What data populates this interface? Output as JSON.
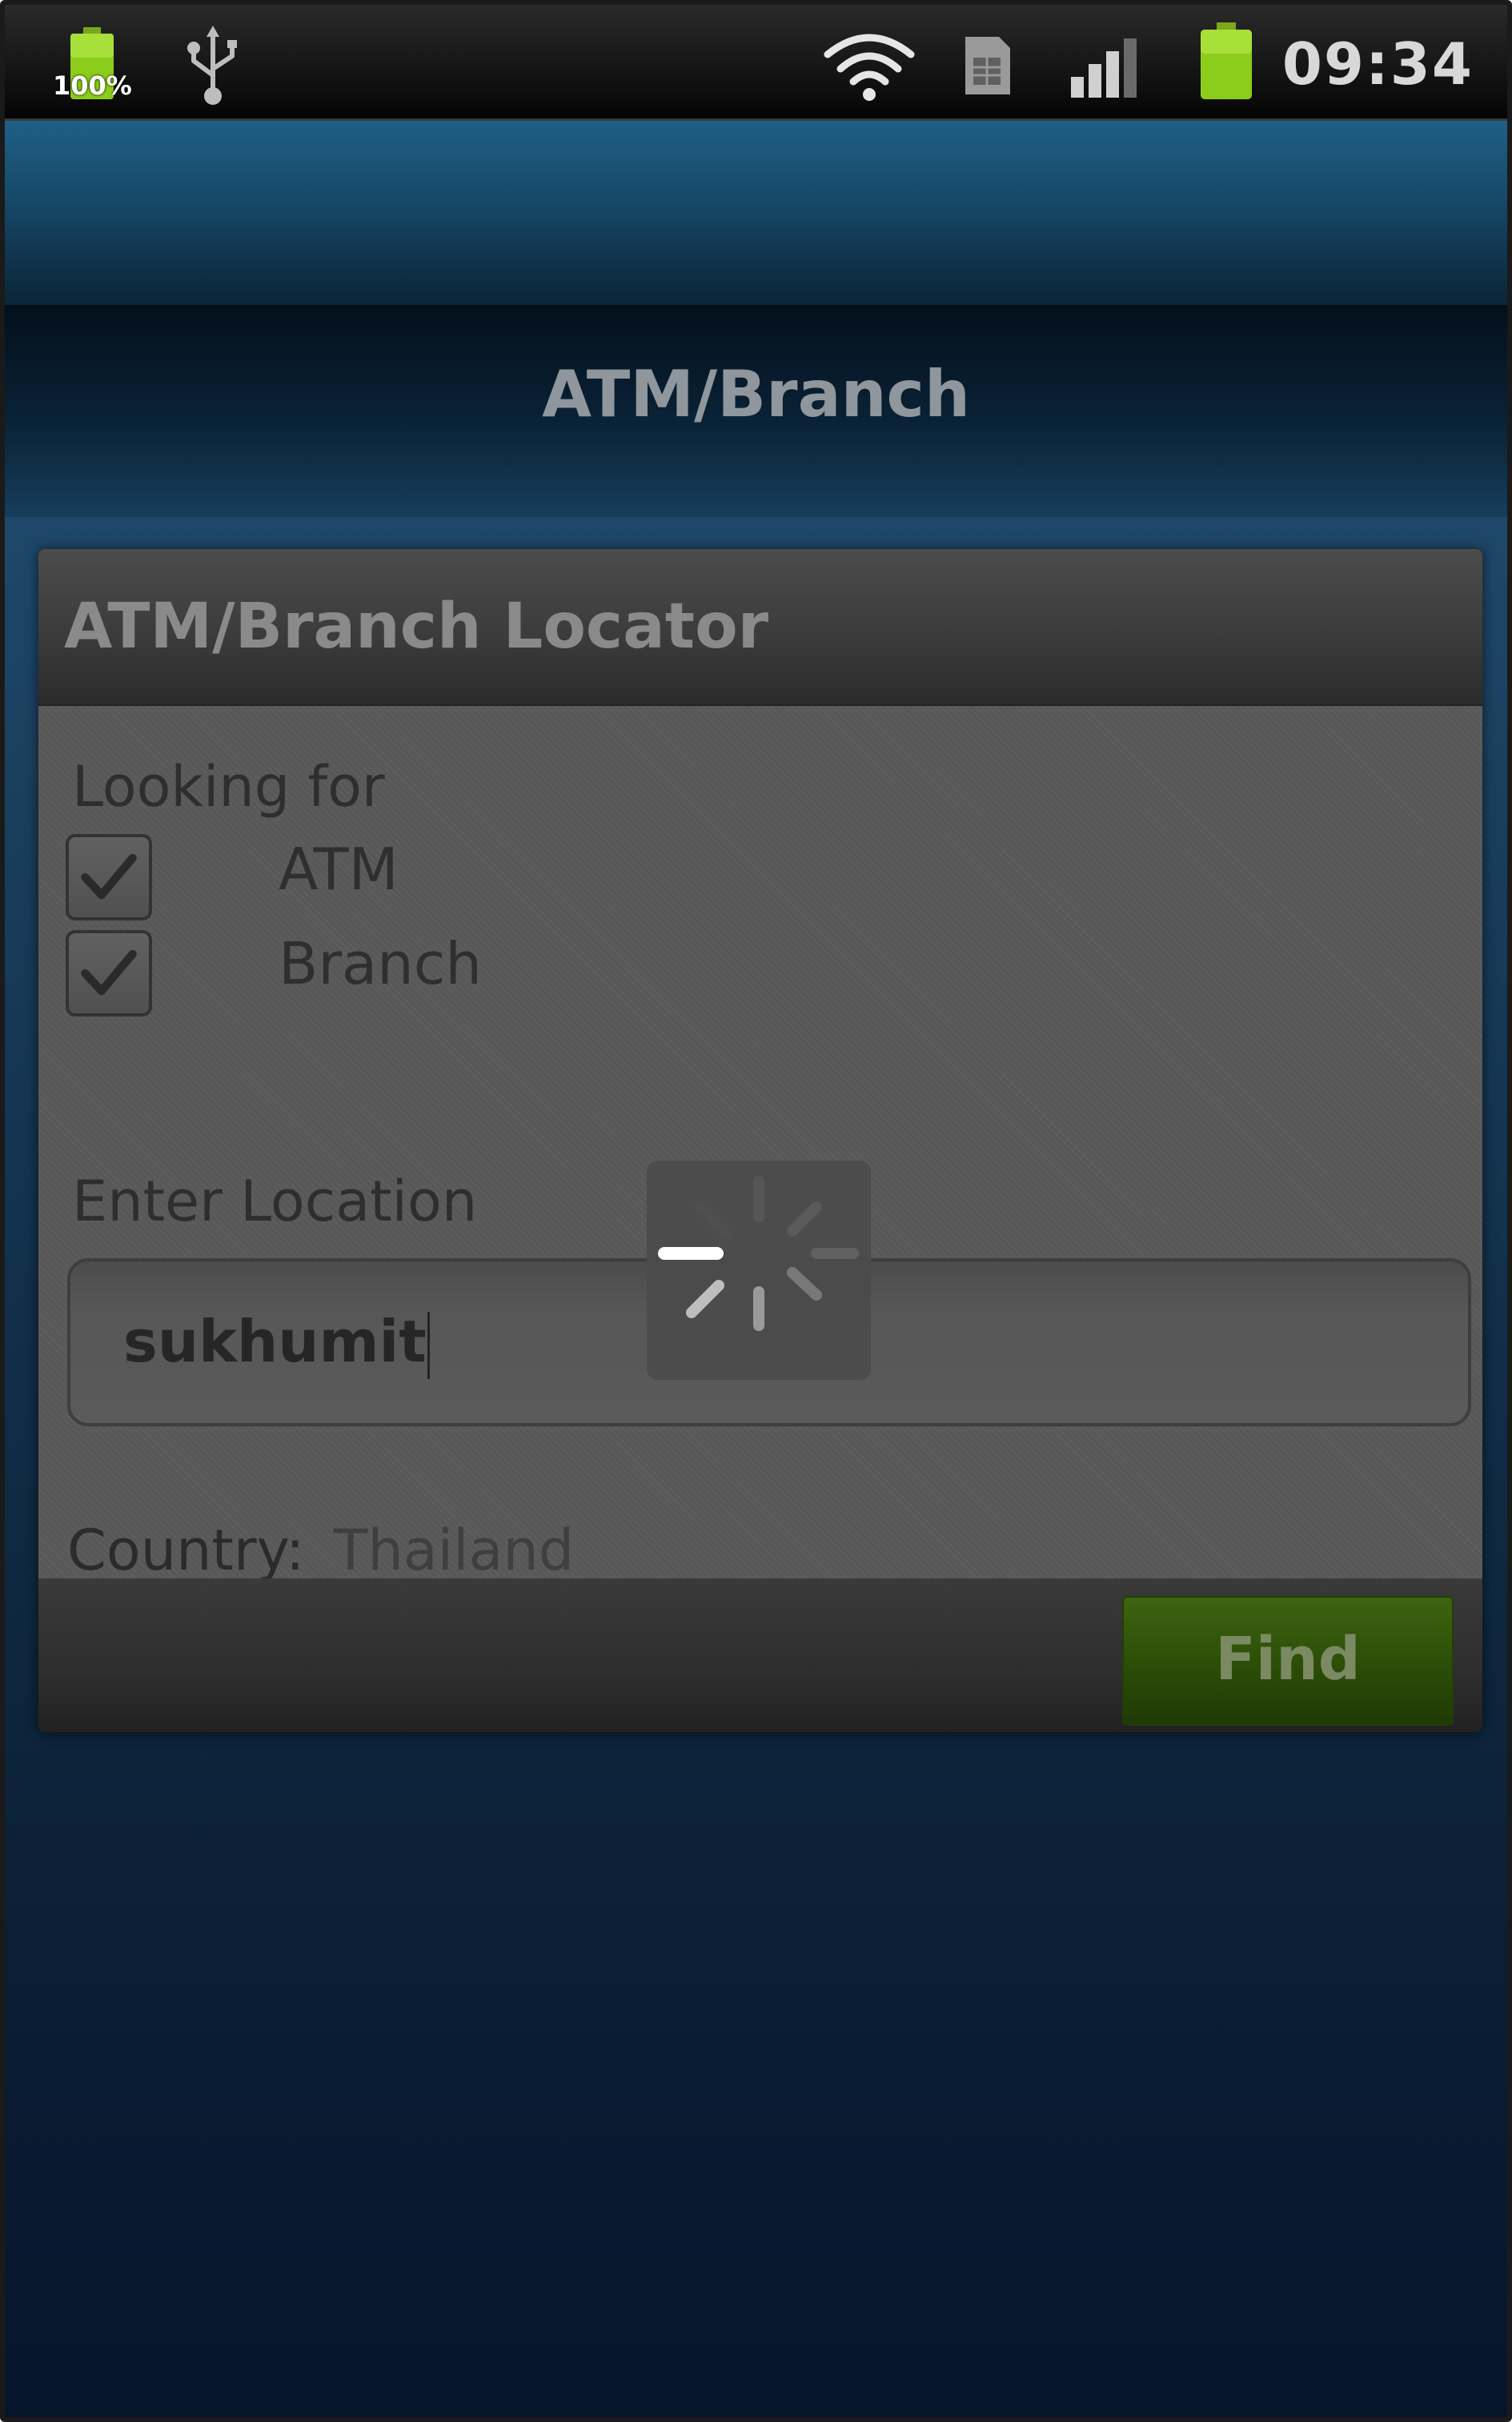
{
  "status_bar": {
    "battery_left_label": "100%",
    "time": "09:34",
    "icons": [
      "battery-icon",
      "usb-icon",
      "wifi-icon",
      "sim-icon",
      "signal-icon",
      "battery-icon"
    ],
    "battery_color": "#8ccc1a"
  },
  "app": {
    "title": "ATM/Branch"
  },
  "dialog": {
    "title": "ATM/Branch Locator",
    "looking_for_label": "Looking for",
    "options": [
      {
        "label": "ATM",
        "checked": true
      },
      {
        "label": "Branch",
        "checked": true
      }
    ],
    "enter_location_label": "Enter Location",
    "location_value": "sukhumit",
    "country_label": "Country:",
    "country_value": "Thailand",
    "find_button_label": "Find",
    "find_button_color": "#2d4f08",
    "loading": true
  }
}
